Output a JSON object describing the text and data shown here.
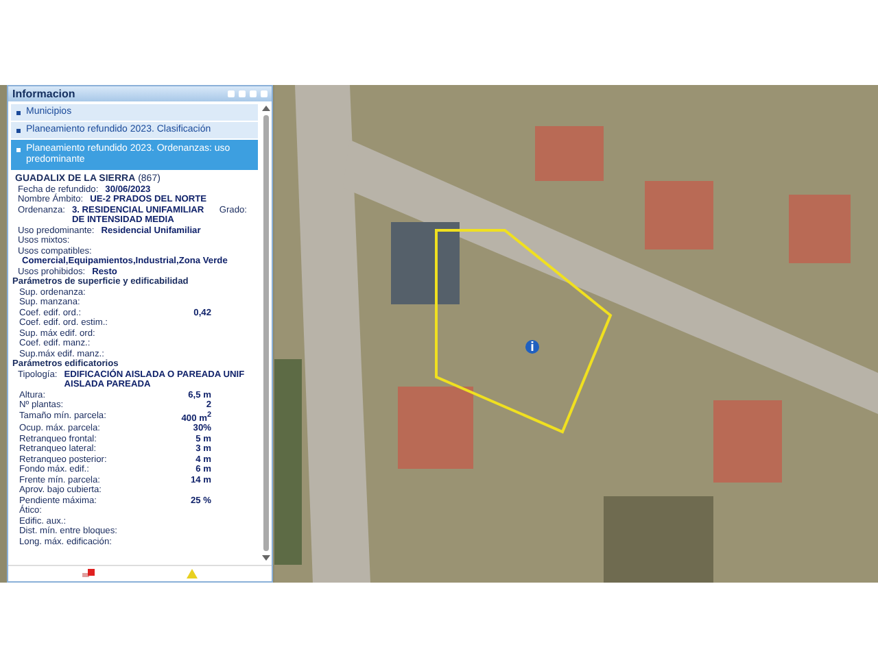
{
  "panel": {
    "title": "Informacion",
    "sections": [
      {
        "label": "Municipios",
        "expanded": false
      },
      {
        "label": "Planeamiento refundido 2023. Clasificación",
        "expanded": false
      },
      {
        "label": "Planeamiento refundido 2023. Ordenanzas: uso predominante",
        "expanded": true
      }
    ],
    "details": [
      {
        "kind": "title",
        "text": "**GUADALIX DE LA SIERRA** (867)"
      },
      {
        "kind": "field",
        "label": "Fecha de refundido:",
        "value": "30/06/2023"
      },
      {
        "kind": "field",
        "label": "Nombre Ámbito:",
        "value": "UE-2 PRADOS DEL NORTE"
      },
      {
        "kind": "field",
        "label": "Ordenanza:",
        "value": "3. RESIDENCIAL UNIFAMILIAR DE INTENSIDAD MEDIA",
        "extra": "Grado:"
      },
      {
        "kind": "field",
        "label": "Uso predominante:",
        "value": "Residencial Unifamiliar"
      },
      {
        "kind": "field",
        "label": "Usos mixtos:"
      },
      {
        "kind": "list",
        "label": "Usos compatibles:",
        "value": "Comercial,Equipamientos,Industrial,Zona Verde"
      },
      {
        "kind": "field",
        "label": "Usos prohibidos:",
        "value": "Resto"
      },
      {
        "kind": "heading",
        "text": "Parámetros de superficie y edificabilidad"
      },
      {
        "kind": "metric",
        "label": "Sup. ordenanza:"
      },
      {
        "kind": "metric",
        "label": "Sup. manzana:"
      },
      {
        "kind": "metric",
        "label": "Coef. edif. ord.:",
        "value": "0,42"
      },
      {
        "kind": "metric",
        "label": "Coef. edif. ord. estim.:"
      },
      {
        "kind": "metric",
        "label": "Sup. máx edif. ord:"
      },
      {
        "kind": "metric",
        "label": "Coef. edif. manz.:"
      },
      {
        "kind": "metric",
        "label": "Sup.máx edif. manz.:"
      },
      {
        "kind": "heading",
        "text": "Parámetros edificatorios"
      },
      {
        "kind": "field",
        "label": "Tipología:",
        "value": "EDIFICACIÓN AISLADA O PAREADA    UNIF AISLADA PAREADA"
      },
      {
        "kind": "metric",
        "label": "Altura:",
        "value": "6,5 m"
      },
      {
        "kind": "metric",
        "label": "Nº plantas:",
        "value": "2"
      },
      {
        "kind": "metric",
        "label": "Tamaño mín. parcela:",
        "value": "400 m$^{2}$"
      },
      {
        "kind": "metric",
        "label": "Ocup. máx. parcela:",
        "value": "30%"
      },
      {
        "kind": "metric",
        "label": "Retranqueo frontal:",
        "value": "5 m"
      },
      {
        "kind": "metric",
        "label": "Retranqueo lateral:",
        "value": "3 m"
      },
      {
        "kind": "metric",
        "label": "Retranqueo posterior:",
        "value": "4 m"
      },
      {
        "kind": "metric",
        "label": "Fondo máx. edif.:",
        "value": "6 m"
      },
      {
        "kind": "metric",
        "label": "Frente mín. parcela:",
        "value": "14 m"
      },
      {
        "kind": "metric",
        "label": "Aprov. bajo cubierta:"
      },
      {
        "kind": "metric",
        "label": "Pendiente máxima:",
        "value": "25 %"
      },
      {
        "kind": "metric",
        "label": "Ático:"
      },
      {
        "kind": "metric",
        "label": "Edific. aux.:"
      },
      {
        "kind": "metric",
        "label": "Dist. mín. entre bloques:"
      },
      {
        "kind": "metric",
        "label": "Long. máx. edificación:"
      }
    ]
  }
}
